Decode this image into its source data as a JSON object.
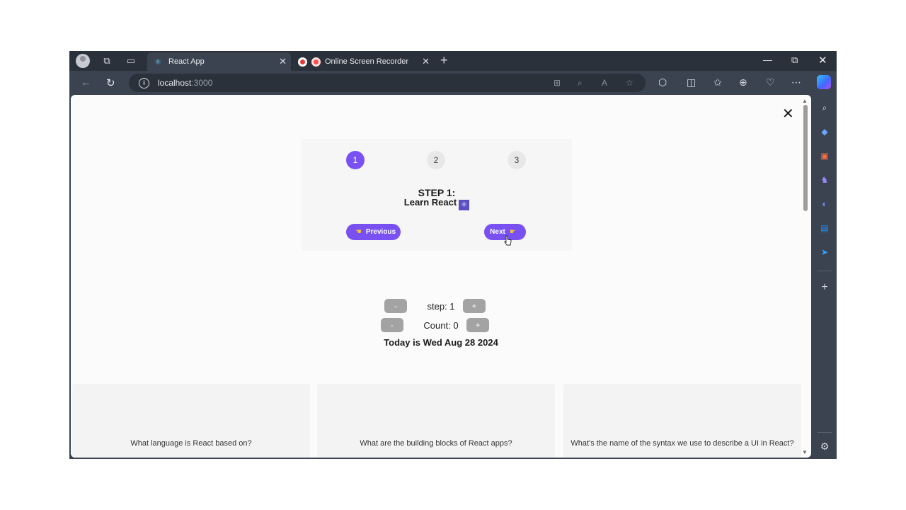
{
  "browser": {
    "tabs": [
      {
        "title": "React App",
        "active": true
      },
      {
        "title": "Online Screen Recorder",
        "active": false
      }
    ],
    "address": {
      "host": "localhost",
      "port": ":3000"
    },
    "accent": "#7950f2"
  },
  "steps": {
    "numbers": [
      "1",
      "2",
      "3"
    ],
    "active_step": 1,
    "title": "STEP 1:",
    "message": "Learn React",
    "message_emoji": "⚛",
    "prev_label": "Previous",
    "next_label": "Next",
    "close_label": "✕"
  },
  "counter": {
    "minus": "-",
    "plus": "+",
    "step_text": "step: 1",
    "count_text": "Count: 0",
    "date_text": "Today is Wed Aug 28 2024"
  },
  "flashcards": [
    {
      "question": "What language is React based on?"
    },
    {
      "question": "What are the building blocks of React apps?"
    },
    {
      "question": "What's the name of the syntax we use to describe a UI in React?"
    }
  ]
}
